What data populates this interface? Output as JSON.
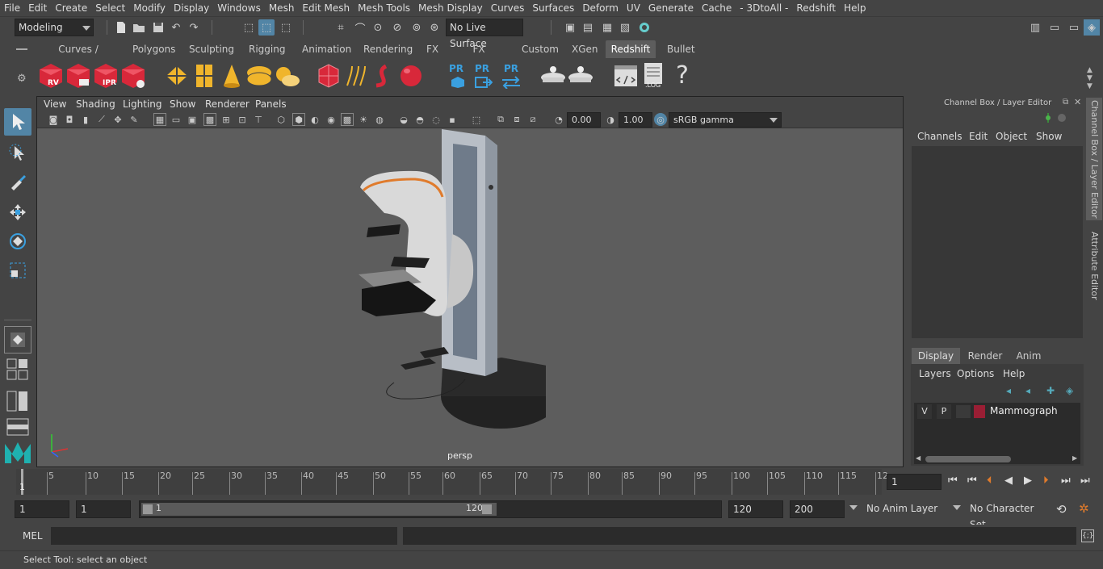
{
  "menubar": {
    "items": [
      "File",
      "Edit",
      "Create",
      "Select",
      "Modify",
      "Display",
      "Windows",
      "Mesh",
      "Edit Mesh",
      "Mesh Tools",
      "Mesh Display",
      "Curves",
      "Surfaces",
      "Deform",
      "UV",
      "Generate",
      "Cache",
      "- 3DtoAll -",
      "Redshift",
      "Help"
    ]
  },
  "statusline": {
    "mode": "Modeling",
    "live_surface": "No Live Surface"
  },
  "shelf": {
    "tabs": [
      "Curves / Surfaces",
      "Polygons",
      "Sculpting",
      "Rigging",
      "Animation",
      "Rendering",
      "FX",
      "FX Caching",
      "Custom",
      "XGen",
      "Redshift",
      "Bullet"
    ],
    "active_tab": "Redshift",
    "icon_labels": {
      "rv": "RV",
      "ipr": "IPR",
      "pr1": "PR",
      "pr2": "PR",
      "pr3": "PR",
      "log": ".LOG",
      "help": "?"
    }
  },
  "viewport": {
    "menus": [
      "View",
      "Shading",
      "Lighting",
      "Show",
      "Renderer",
      "Panels"
    ],
    "exposure": "0.00",
    "gamma": "1.00",
    "color_space": "sRGB gamma",
    "camera_label": "persp"
  },
  "channelbox": {
    "title": "Channel Box / Layer Editor",
    "menus": [
      "Channels",
      "Edit",
      "Object",
      "Show"
    ],
    "layer_tabs": [
      "Display",
      "Render",
      "Anim"
    ],
    "active_layer_tab": "Display",
    "layer_menus": [
      "Layers",
      "Options",
      "Help"
    ],
    "layer": {
      "v": "V",
      "p": "P",
      "name": "Mammograph",
      "color": "#9a1e34"
    }
  },
  "side_tabs": [
    "Channel Box / Layer Editor",
    "Attribute Editor"
  ],
  "timeline": {
    "ticks": [
      "5",
      "10",
      "15",
      "20",
      "25",
      "30",
      "35",
      "40",
      "45",
      "50",
      "55",
      "60",
      "65",
      "70",
      "75",
      "80",
      "85",
      "90",
      "95",
      "100",
      "105",
      "110",
      "115",
      "12"
    ],
    "start_label": "1",
    "current_frame": "1"
  },
  "range": {
    "start": "1",
    "playback_start": "1",
    "slider_start": "1",
    "slider_end": "120",
    "playback_end": "120",
    "end": "200",
    "anim_layer": "No Anim Layer",
    "char_set": "No Character Set"
  },
  "command": {
    "lang": "MEL",
    "help_text": "Select Tool: select an object"
  },
  "colors": {
    "accent": "#5285a6",
    "active_tab": "#5d5d5d",
    "layer_color": "#9a1e34"
  }
}
